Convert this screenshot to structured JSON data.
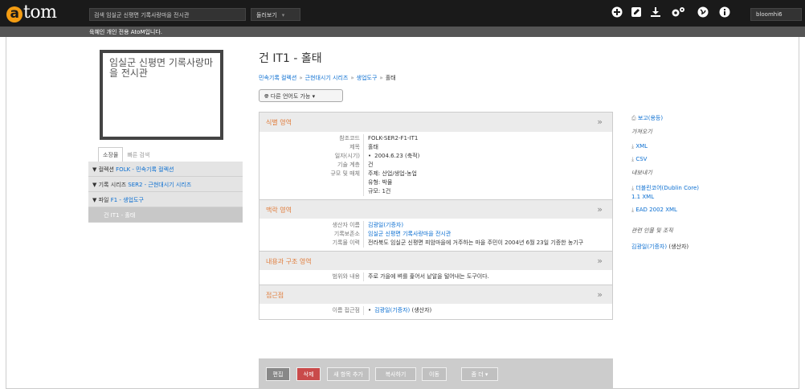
{
  "header": {
    "logo_letter": "a",
    "logo_rest": "tom",
    "search_placeholder": "검색 임실군 신평면 기록사랑마을 전시관",
    "browse_label": "둘러보기",
    "icons": [
      "plus-circle-icon",
      "edit-icon",
      "download-icon",
      "settings-icon",
      "globe-icon",
      "info-icon"
    ],
    "user": "bloomhi6"
  },
  "banner": "육혜인 개인 전용 AtoM입니다.",
  "repository": {
    "name": "임실군 신평면 기록사랑마을 전시관"
  },
  "tabs": {
    "holdings": "소장물",
    "quick_search": "빠른 검색"
  },
  "tree": [
    {
      "prefix": "▼ 컬렉션 ",
      "link": "FOLK - 민속기록 컬렉션"
    },
    {
      "prefix": "▼ 기록 시리즈 ",
      "link": "SER2 - 근현대시기 시리즈"
    },
    {
      "prefix": "▼ 파일 ",
      "link": "F1 - 생업도구"
    },
    {
      "prefix": "",
      "link": "",
      "current": "건 IT1 - 홀태"
    }
  ],
  "record": {
    "title": "건 IT1 - 홀태",
    "breadcrumb": [
      "민속기록 컬렉션",
      "근현대시기 시리즈",
      "생업도구",
      "홀태"
    ],
    "language_button": "다른 언어도 가능"
  },
  "sections": {
    "identity": {
      "title": "식별 영역",
      "ref_label": "참조코드",
      "ref_value": "FOLK-SER2-F1-IT1",
      "title_label": "제목",
      "title_value": "홀태",
      "date_label": "일자(시기)",
      "date_value": "2004.6.23 (축적)",
      "level_label": "기술 계층",
      "level_value": "건",
      "extent_label": "규모 및 매체",
      "extent_lines": [
        "주제: 산업/생업-농업",
        "유형: 박물",
        "규모: 1건"
      ]
    },
    "context": {
      "title": "맥락 영역",
      "creator_label": "생산자 이름",
      "creator_value": "김광일(기증자)",
      "repo_label": "기록보존소",
      "repo_value": "임실군 신평면 기록사랑마을 전시관",
      "history_label": "기록물 이력",
      "history_value": "전라북도 임실군 신평면 피암마을에 거주하는 마을 주민이 2004년 6월 23일 기증한 농기구"
    },
    "content": {
      "title": "내용과 구조 영역",
      "scope_label": "범위와 내용",
      "scope_value": "주로 가을에 벼를 훑어서 낱알을 털어내는 도구이다."
    },
    "access": {
      "title": "접근점",
      "name_label": "이름 접근점",
      "name_value": "김광일(기증자)",
      "name_role": " (생산자)"
    }
  },
  "actions": {
    "edit": "편집",
    "delete": "삭제",
    "add_new": "새 항목 추가",
    "duplicate": "복사하기",
    "move": "이동",
    "more": "좀 더"
  },
  "sidebar": {
    "report": "보고(용등)",
    "import_heading": "가져오기",
    "import_xml": "XML",
    "import_csv": "CSV",
    "export_heading": "내보내기",
    "export_dc_1": "더블린코어(Dublin Core)",
    "export_dc_2": "1.1 XML",
    "export_ead": "EAD 2002 XML",
    "related_heading": "관련 인물 및 조직",
    "related_link": "김광일(기증자)",
    "related_role": " (생산자)"
  }
}
